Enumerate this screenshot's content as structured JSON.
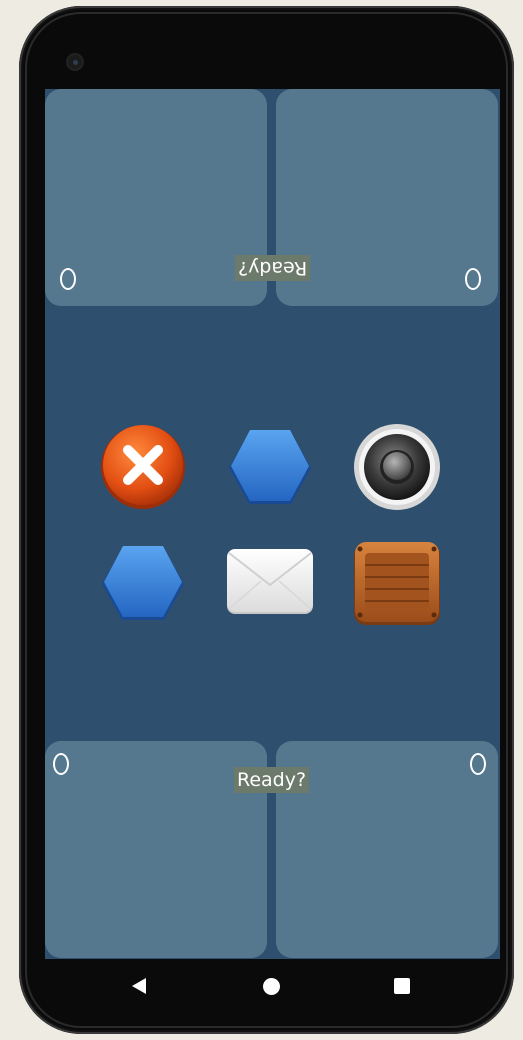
{
  "top_prompt": "Ready?",
  "bottom_prompt": "Ready?",
  "corner_markers": [
    "O",
    "O",
    "O",
    "O"
  ],
  "tiles": [
    {
      "icon": "close-x-icon",
      "color": "#e8541a"
    },
    {
      "icon": "blue-hexagon-icon",
      "color": "#3f86d8"
    },
    {
      "icon": "speaker-icon",
      "color": "#3a3a3a"
    },
    {
      "icon": "blue-hexagon-icon",
      "color": "#3f86d8"
    },
    {
      "icon": "envelope-icon",
      "color": "#f2f2f2"
    },
    {
      "icon": "wooden-crate-icon",
      "color": "#b9652a"
    }
  ],
  "nav": [
    "back",
    "home",
    "recents"
  ],
  "colors": {
    "background": "#2e4f6d",
    "pad": "#56788f",
    "label_bg": "#6c7a6b"
  }
}
